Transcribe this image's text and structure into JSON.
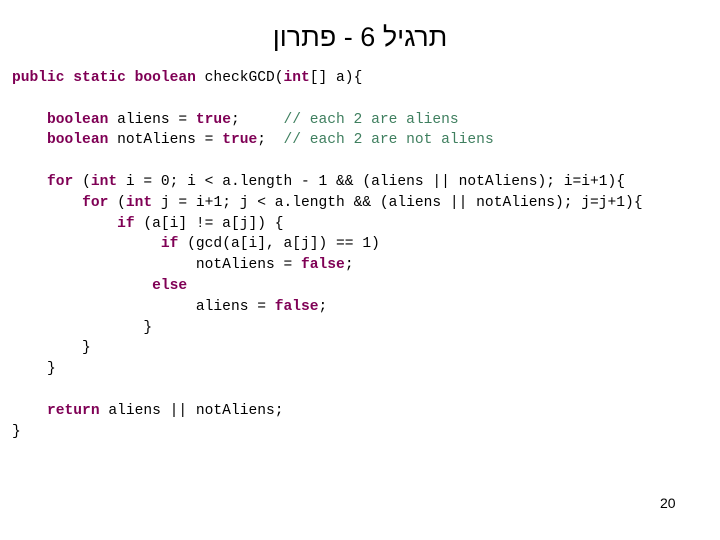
{
  "slide": {
    "title": "תרגיל 6 - פתרון",
    "page_number": "20",
    "colors": {
      "keyword": "#7F0055",
      "comment": "#3F7F5F",
      "text": "#000000"
    }
  },
  "code": {
    "lines": [
      [
        {
          "t": "public static boolean",
          "k": "kw"
        },
        {
          "t": " checkGCD("
        },
        {
          "t": "int",
          "k": "kw"
        },
        {
          "t": "[] a){"
        }
      ],
      [],
      [
        {
          "t": "    "
        },
        {
          "t": "boolean",
          "k": "kw"
        },
        {
          "t": " aliens = "
        },
        {
          "t": "true",
          "k": "kw"
        },
        {
          "t": ";     "
        },
        {
          "t": "// each 2 are aliens",
          "k": "cm"
        }
      ],
      [
        {
          "t": "    "
        },
        {
          "t": "boolean",
          "k": "kw"
        },
        {
          "t": " notAliens = "
        },
        {
          "t": "true",
          "k": "kw"
        },
        {
          "t": ";  "
        },
        {
          "t": "// each 2 are not aliens",
          "k": "cm"
        }
      ],
      [],
      [
        {
          "t": "    "
        },
        {
          "t": "for",
          "k": "kw"
        },
        {
          "t": " ("
        },
        {
          "t": "int",
          "k": "kw"
        },
        {
          "t": " i = 0; i < a.length - 1 && (aliens || notAliens); i=i+1){"
        }
      ],
      [
        {
          "t": "        "
        },
        {
          "t": "for",
          "k": "kw"
        },
        {
          "t": " ("
        },
        {
          "t": "int",
          "k": "kw"
        },
        {
          "t": " j = i+1; j < a.length && (aliens || notAliens); j=j+1){"
        }
      ],
      [
        {
          "t": "            "
        },
        {
          "t": "if",
          "k": "kw"
        },
        {
          "t": " (a[i] != a[j]) {"
        }
      ],
      [
        {
          "t": "                 "
        },
        {
          "t": "if",
          "k": "kw"
        },
        {
          "t": " (gcd(a[i], a[j]) == 1)"
        }
      ],
      [
        {
          "t": "                     notAliens = "
        },
        {
          "t": "false",
          "k": "kw"
        },
        {
          "t": ";"
        }
      ],
      [
        {
          "t": "                "
        },
        {
          "t": "else",
          "k": "kw"
        }
      ],
      [
        {
          "t": "                     aliens = "
        },
        {
          "t": "false",
          "k": "kw"
        },
        {
          "t": ";"
        }
      ],
      [
        {
          "t": "               }"
        }
      ],
      [
        {
          "t": "        }"
        }
      ],
      [
        {
          "t": "    }"
        }
      ],
      [],
      [
        {
          "t": "    "
        },
        {
          "t": "return",
          "k": "kw"
        },
        {
          "t": " aliens || notAliens;"
        }
      ],
      [
        {
          "t": "}"
        }
      ]
    ]
  }
}
